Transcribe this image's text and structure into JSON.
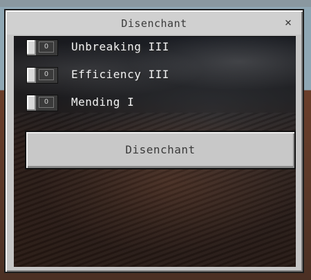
{
  "dialog": {
    "title": "Disenchant",
    "close_icon": "close-icon",
    "close_glyph": "×"
  },
  "enchantments": [
    {
      "label": "Unbreaking III",
      "toggle_state": "O",
      "enabled": false
    },
    {
      "label": "Efficiency III",
      "toggle_state": "O",
      "enabled": false
    },
    {
      "label": "Mending I",
      "toggle_state": "O",
      "enabled": false
    }
  ],
  "action": {
    "button_label": "Disenchant"
  },
  "colors": {
    "panel": "#c6c6c6",
    "toggle_track": "#3a3a3a",
    "label_text": "#f2f2f2"
  }
}
